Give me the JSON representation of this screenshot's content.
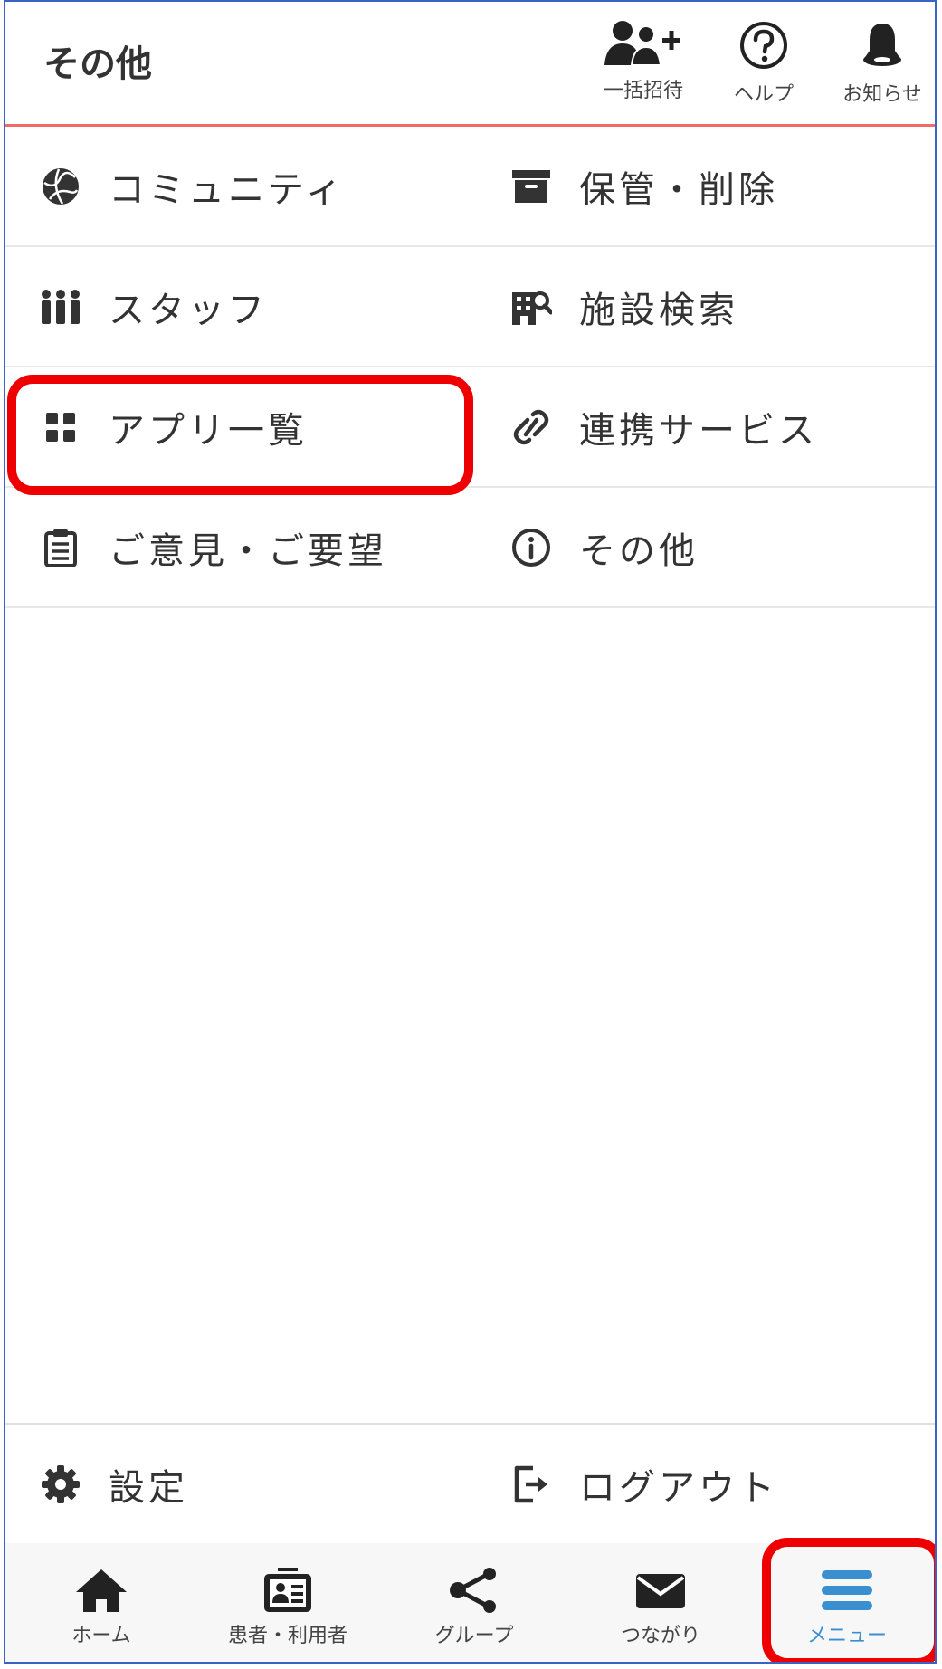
{
  "header": {
    "title": "その他",
    "buttons": [
      {
        "label": "一括招待",
        "icon": "add-users-icon"
      },
      {
        "label": "ヘルプ",
        "icon": "help-icon"
      },
      {
        "label": "お知らせ",
        "icon": "bell-icon"
      }
    ],
    "accent_color": "#f06a6a"
  },
  "menu": {
    "items": [
      {
        "label": "コミュニティ",
        "icon": "globe-icon"
      },
      {
        "label": "保管・削除",
        "icon": "archive-icon"
      },
      {
        "label": "スタッフ",
        "icon": "staff-icon"
      },
      {
        "label": "施設検索",
        "icon": "facility-search-icon"
      },
      {
        "label": "アプリ一覧",
        "icon": "apps-grid-icon"
      },
      {
        "label": "連携サービス",
        "icon": "link-icon"
      },
      {
        "label": "ご意見・ご要望",
        "icon": "clipboard-icon"
      },
      {
        "label": "その他",
        "icon": "info-icon"
      }
    ]
  },
  "footer_menu": {
    "settings_label": "設定",
    "logout_label": "ログアウト"
  },
  "tabbar": {
    "tabs": [
      {
        "label": "ホーム",
        "icon": "home-icon"
      },
      {
        "label": "患者・利用者",
        "icon": "id-card-icon"
      },
      {
        "label": "グループ",
        "icon": "share-icon"
      },
      {
        "label": "つながり",
        "icon": "mail-icon"
      },
      {
        "label": "メニュー",
        "icon": "menu-icon",
        "active": true
      }
    ],
    "active_color": "#3a8fd0"
  },
  "highlight_color": "#ee0000"
}
